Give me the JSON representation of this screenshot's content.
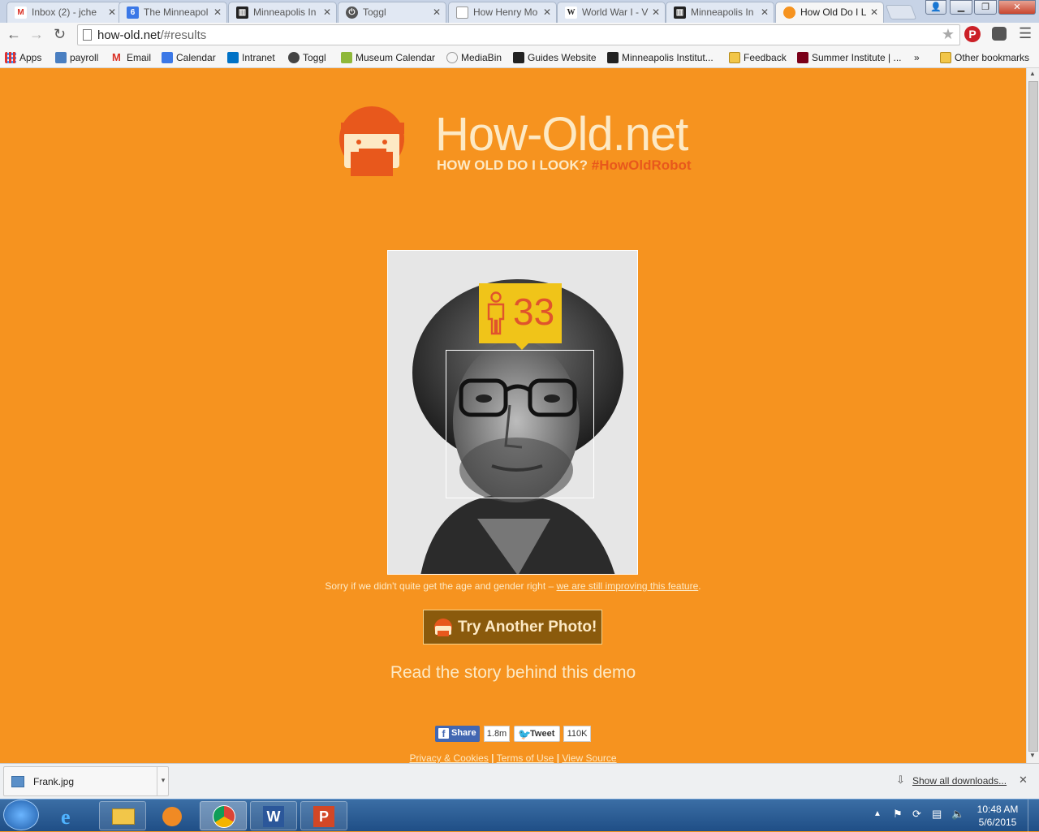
{
  "browser": {
    "tabs": [
      {
        "title": "Inbox (2) - jche",
        "favicon": "gmail-icon"
      },
      {
        "title": "The Minneapol",
        "favicon": "calendar-icon"
      },
      {
        "title": "Minneapolis In",
        "favicon": "mia-icon"
      },
      {
        "title": "Toggl",
        "favicon": "toggl-icon"
      },
      {
        "title": "How Henry Mo",
        "favicon": "page-icon"
      },
      {
        "title": "World War I - V",
        "favicon": "wikipedia-icon"
      },
      {
        "title": "Minneapolis In",
        "favicon": "mia-icon"
      },
      {
        "title": "How Old Do I L",
        "favicon": "howold-icon"
      }
    ],
    "address": {
      "domain": "how-old.net",
      "path": "/#results"
    },
    "bookmarks": [
      {
        "label": "Apps"
      },
      {
        "label": "payroll"
      },
      {
        "label": "Email"
      },
      {
        "label": "Calendar"
      },
      {
        "label": "Intranet"
      },
      {
        "label": "Toggl"
      },
      {
        "label": "Museum Calendar"
      },
      {
        "label": "MediaBin"
      },
      {
        "label": "Guides Website"
      },
      {
        "label": "Minneapolis Institut..."
      },
      {
        "label": "Feedback"
      },
      {
        "label": "Summer Institute | ..."
      }
    ],
    "bookmarks_more": "»",
    "other_bookmarks": "Other bookmarks"
  },
  "page": {
    "title": "How-Old.net",
    "subtitle": "HOW OLD DO I LOOK?",
    "hashtag": "#HowOldRobot",
    "age": "33",
    "sorry_text": "Sorry if we didn't quite get the age and gender right – ",
    "sorry_link": "we are still improving this feature",
    "sorry_end": ".",
    "try_button": "Try Another Photo!",
    "story_link": "Read the story behind this demo",
    "share_label": "Share",
    "share_count": "1.8m",
    "tweet_label": "Tweet",
    "tweet_count": "110K",
    "footer_privacy": "Privacy & Cookies",
    "footer_terms": "Terms of Use",
    "footer_source": "View Source"
  },
  "downloads": {
    "file": "Frank.jpg",
    "show_all": "Show all downloads..."
  },
  "taskbar": {
    "time": "10:48 AM",
    "date": "5/6/2015"
  },
  "colors": {
    "page_bg": "#f6931f",
    "cream": "#fde9c4",
    "accent": "#e8581c",
    "badge": "#f0c419"
  }
}
